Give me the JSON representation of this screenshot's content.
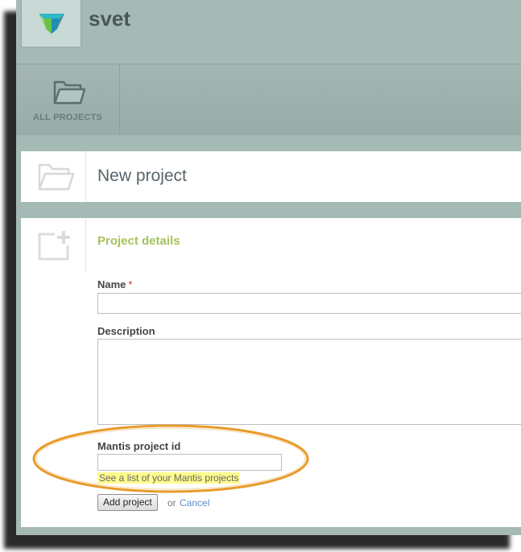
{
  "header": {
    "app_name": "svet",
    "logo_icon": "app-logo-icon"
  },
  "nav": {
    "items": [
      {
        "label": "ALL PROJECTS",
        "icon": "folder-icon"
      }
    ]
  },
  "title_panel": {
    "title": "New project",
    "icon": "folder-outline-icon"
  },
  "form": {
    "icon": "add-document-icon",
    "section_title": "Project details",
    "name": {
      "label": "Name",
      "required_marker": "*",
      "value": ""
    },
    "description": {
      "label": "Description",
      "value": ""
    },
    "mantis": {
      "label": "Mantis project id",
      "value": "",
      "hint": "See a list of your Mantis projects"
    },
    "submit_label": "Add project",
    "or_text": "or",
    "cancel_label": "Cancel"
  },
  "colors": {
    "accent_green": "#a6c25c",
    "header_bg": "#a5b9b5",
    "highlight_yellow": "#fffb8c",
    "annotation_orange": "#e89a2c",
    "link_blue": "#5b8fc9"
  }
}
